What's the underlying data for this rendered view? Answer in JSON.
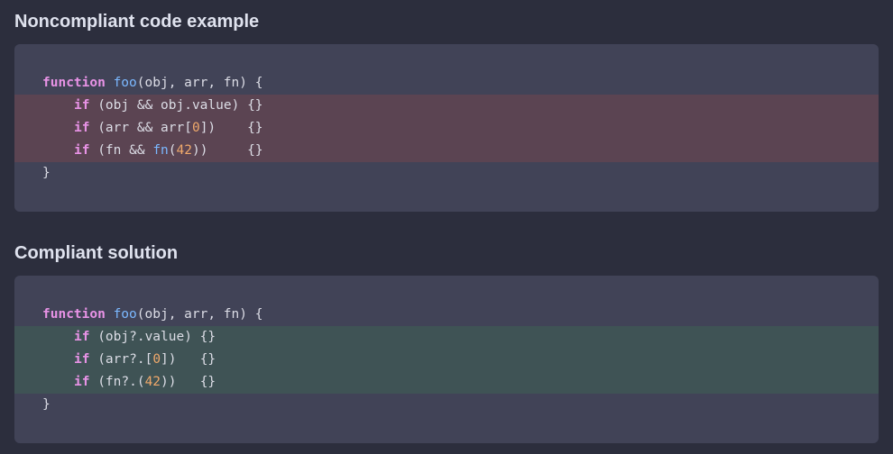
{
  "noncompliant": {
    "heading": "Noncompliant code example",
    "lines": [
      {
        "parts": [
          {
            "t": "function",
            "c": "kw"
          },
          {
            "t": " "
          },
          {
            "t": "foo",
            "c": "fn"
          },
          {
            "t": "(obj, arr, fn) {"
          }
        ]
      },
      {
        "highlight": "red",
        "indent": true,
        "parts": [
          {
            "t": "if",
            "c": "kw"
          },
          {
            "t": " (obj && obj.value) {}"
          }
        ]
      },
      {
        "highlight": "red",
        "indent": true,
        "parts": [
          {
            "t": "if",
            "c": "kw"
          },
          {
            "t": " (arr && arr["
          },
          {
            "t": "0",
            "c": "num"
          },
          {
            "t": "])    {}"
          }
        ]
      },
      {
        "highlight": "red",
        "indent": true,
        "parts": [
          {
            "t": "if",
            "c": "kw"
          },
          {
            "t": " (fn && "
          },
          {
            "t": "fn",
            "c": "fn"
          },
          {
            "t": "("
          },
          {
            "t": "42",
            "c": "num"
          },
          {
            "t": "))     {}"
          }
        ]
      },
      {
        "parts": [
          {
            "t": "}"
          }
        ]
      }
    ]
  },
  "compliant": {
    "heading": "Compliant solution",
    "lines": [
      {
        "parts": [
          {
            "t": "function",
            "c": "kw"
          },
          {
            "t": " "
          },
          {
            "t": "foo",
            "c": "fn"
          },
          {
            "t": "(obj, arr, fn) {"
          }
        ]
      },
      {
        "highlight": "green",
        "indent": true,
        "parts": [
          {
            "t": "if",
            "c": "kw"
          },
          {
            "t": " (obj?.value) {}"
          }
        ]
      },
      {
        "highlight": "green",
        "indent": true,
        "parts": [
          {
            "t": "if",
            "c": "kw"
          },
          {
            "t": " (arr?.["
          },
          {
            "t": "0",
            "c": "num"
          },
          {
            "t": "])   {}"
          }
        ]
      },
      {
        "highlight": "green",
        "indent": true,
        "parts": [
          {
            "t": "if",
            "c": "kw"
          },
          {
            "t": " (fn?.("
          },
          {
            "t": "42",
            "c": "num"
          },
          {
            "t": "))   {}"
          }
        ]
      },
      {
        "parts": [
          {
            "t": "}"
          }
        ]
      }
    ]
  },
  "colors": {
    "background": "#2c2e3d",
    "code_background": "#414357",
    "highlight_red": "#5b4452",
    "highlight_green": "#3f5355",
    "keyword": "#e893e6",
    "function_name": "#7bb8ff",
    "number": "#f0a96b"
  }
}
